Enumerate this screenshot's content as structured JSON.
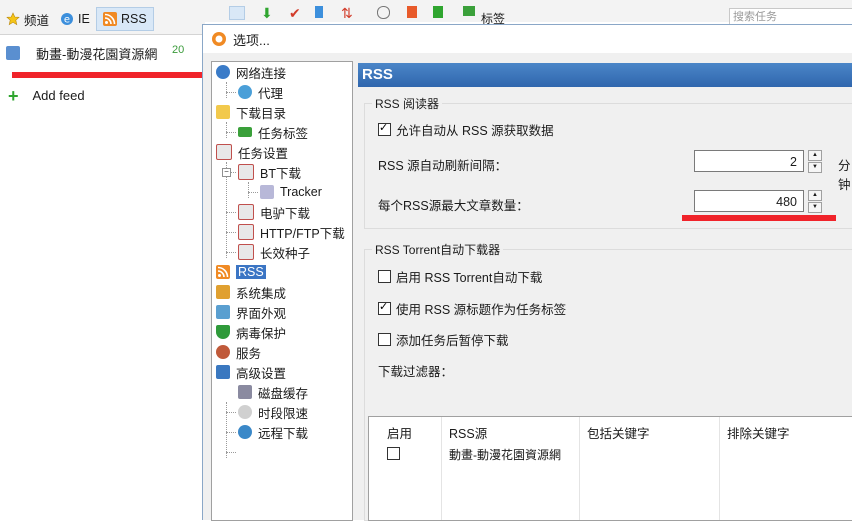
{
  "app": {
    "tabs": [
      {
        "label": "频道",
        "icon": "star-icon"
      },
      {
        "label": "IE",
        "icon": "ie-icon"
      },
      {
        "label": "RSS",
        "icon": "rss-icon"
      }
    ],
    "search_placeholder": "搜索任务",
    "toolbar_tag_label": "标签",
    "feed": {
      "name": "動畫-動漫花園資源網",
      "count": "20"
    },
    "add_feed_label": "Add feed"
  },
  "dialog": {
    "title": "选项...",
    "tree": [
      {
        "label": "网络连接",
        "icon": "network-icon"
      },
      {
        "label": "代理",
        "icon": "globe-icon"
      },
      {
        "label": "下载目录",
        "icon": "folder-icon"
      },
      {
        "label": "任务标签",
        "icon": "tag-icon"
      },
      {
        "label": "任务设置",
        "icon": "clipboard-icon"
      },
      {
        "label": "BT下载",
        "icon": "clipboard-icon"
      },
      {
        "label": "Tracker",
        "icon": "cube-icon"
      },
      {
        "label": "电驴下载",
        "icon": "clipboard-icon"
      },
      {
        "label": "HTTP/FTP下载",
        "icon": "clipboard-icon"
      },
      {
        "label": "长效种子",
        "icon": "clipboard-icon"
      },
      {
        "label": "RSS",
        "icon": "rss-icon"
      },
      {
        "label": "系统集成",
        "icon": "puzzle-icon"
      },
      {
        "label": "界面外观",
        "icon": "paint-icon"
      },
      {
        "label": "病毒保护",
        "icon": "shield-icon"
      },
      {
        "label": "服务",
        "icon": "people-icon"
      },
      {
        "label": "高级设置",
        "icon": "gear-icon"
      },
      {
        "label": "磁盘缓存",
        "icon": "disk-icon"
      },
      {
        "label": "时段限速",
        "icon": "clock-icon"
      },
      {
        "label": "远程下载",
        "icon": "remote-icon"
      }
    ],
    "panel": {
      "header": "RSS",
      "reader_group": "RSS 阅读器",
      "allow_auto_fetch": "允许自动从 RSS 源获取数据",
      "refresh_interval_label": "RSS 源自动刷新间隔：",
      "refresh_interval_value": "2",
      "refresh_unit": "分钟",
      "max_articles_label": "每个RSS源最大文章数量：",
      "max_articles_value": "480",
      "torrent_group": "RSS Torrent自动下载器",
      "enable_torrent_auto": "启用 RSS Torrent自动下载",
      "use_title_as_tag": "使用 RSS 源标题作为任务标签",
      "pause_after_add": "添加任务后暂停下载",
      "filter_label": "下载过滤器：",
      "filter_columns": [
        "启用",
        "RSS源",
        "包括关键字",
        "排除关键字"
      ],
      "filter_rows": [
        {
          "source": "動畫-動漫花園資源網"
        }
      ]
    }
  }
}
